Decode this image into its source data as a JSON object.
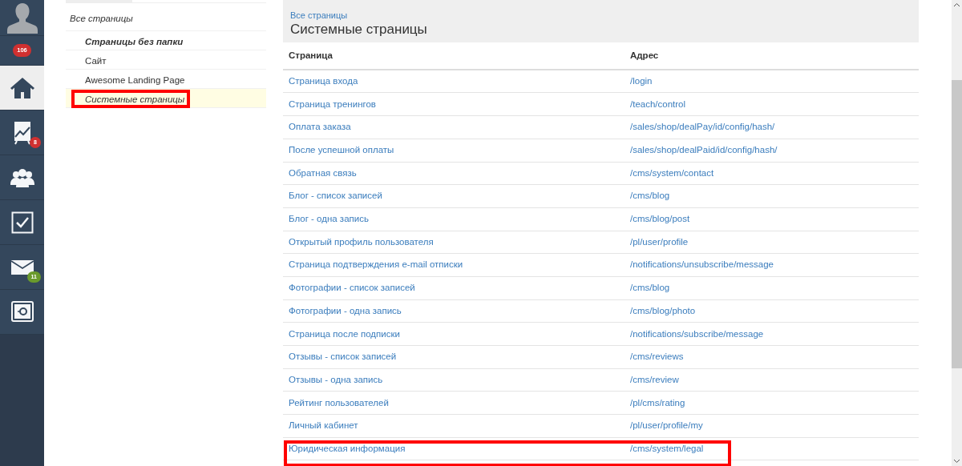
{
  "sidebar": {
    "items": [
      {
        "kind": "avatar",
        "selected": false
      },
      {
        "kind": "counter",
        "badge": "106",
        "selected": false
      },
      {
        "kind": "home",
        "selected": true
      },
      {
        "kind": "chart",
        "badge": "8",
        "selected": false
      },
      {
        "kind": "people",
        "selected": false
      },
      {
        "kind": "tasks",
        "selected": false
      },
      {
        "kind": "mail",
        "badge": "11",
        "color": "#6a9a2c",
        "selected": false
      },
      {
        "kind": "safe",
        "selected": false
      }
    ]
  },
  "folders": {
    "title": "Все страницы",
    "items": [
      {
        "label": "Страницы без папки",
        "kind": "bold",
        "selected": false,
        "highlighted": false
      },
      {
        "label": "Сайт",
        "kind": "plain",
        "selected": false,
        "highlighted": false
      },
      {
        "label": "Awesome Landing Page",
        "kind": "plain",
        "selected": false,
        "highlighted": false
      },
      {
        "label": "Системные страницы",
        "kind": "italic",
        "selected": true,
        "highlighted": true
      }
    ]
  },
  "header": {
    "breadcrumb": "Все страницы",
    "title": "Системные страницы"
  },
  "table": {
    "columns": [
      "Страница",
      "Адрес"
    ],
    "rows": [
      {
        "page": "Страница входа",
        "address": "/login",
        "highlighted": false
      },
      {
        "page": "Страница тренингов",
        "address": "/teach/control",
        "highlighted": false
      },
      {
        "page": "Оплата заказа",
        "address": "/sales/shop/dealPay/id/config/hash/",
        "highlighted": false
      },
      {
        "page": "После успешной оплаты",
        "address": "/sales/shop/dealPaid/id/config/hash/",
        "highlighted": false
      },
      {
        "page": "Обратная связь",
        "address": "/cms/system/contact",
        "highlighted": false
      },
      {
        "page": "Блог - список записей",
        "address": "/cms/blog",
        "highlighted": false
      },
      {
        "page": "Блог - одна запись",
        "address": "/cms/blog/post",
        "highlighted": false
      },
      {
        "page": "Открытый профиль пользователя",
        "address": "/pl/user/profile",
        "highlighted": false
      },
      {
        "page": "Страница подтверждения e-mail отписки",
        "address": "/notifications/unsubscribe/message",
        "highlighted": false
      },
      {
        "page": "Фотографии - список записей",
        "address": "/cms/blog",
        "highlighted": false
      },
      {
        "page": "Фотографии - одна запись",
        "address": "/cms/blog/photo",
        "highlighted": false
      },
      {
        "page": "Страница после подписки",
        "address": "/notifications/subscribe/message",
        "highlighted": false
      },
      {
        "page": "Отзывы - список записей",
        "address": "/cms/reviews",
        "highlighted": false
      },
      {
        "page": "Отзывы - одна запись",
        "address": "/cms/review",
        "highlighted": false
      },
      {
        "page": "Рейтинг пользователей",
        "address": "/pl/cms/rating",
        "highlighted": false
      },
      {
        "page": "Личный кабинет",
        "address": "/pl/user/profile/my",
        "highlighted": false
      },
      {
        "page": "Юридическая информация",
        "address": "/cms/system/legal",
        "highlighted": true
      }
    ]
  }
}
